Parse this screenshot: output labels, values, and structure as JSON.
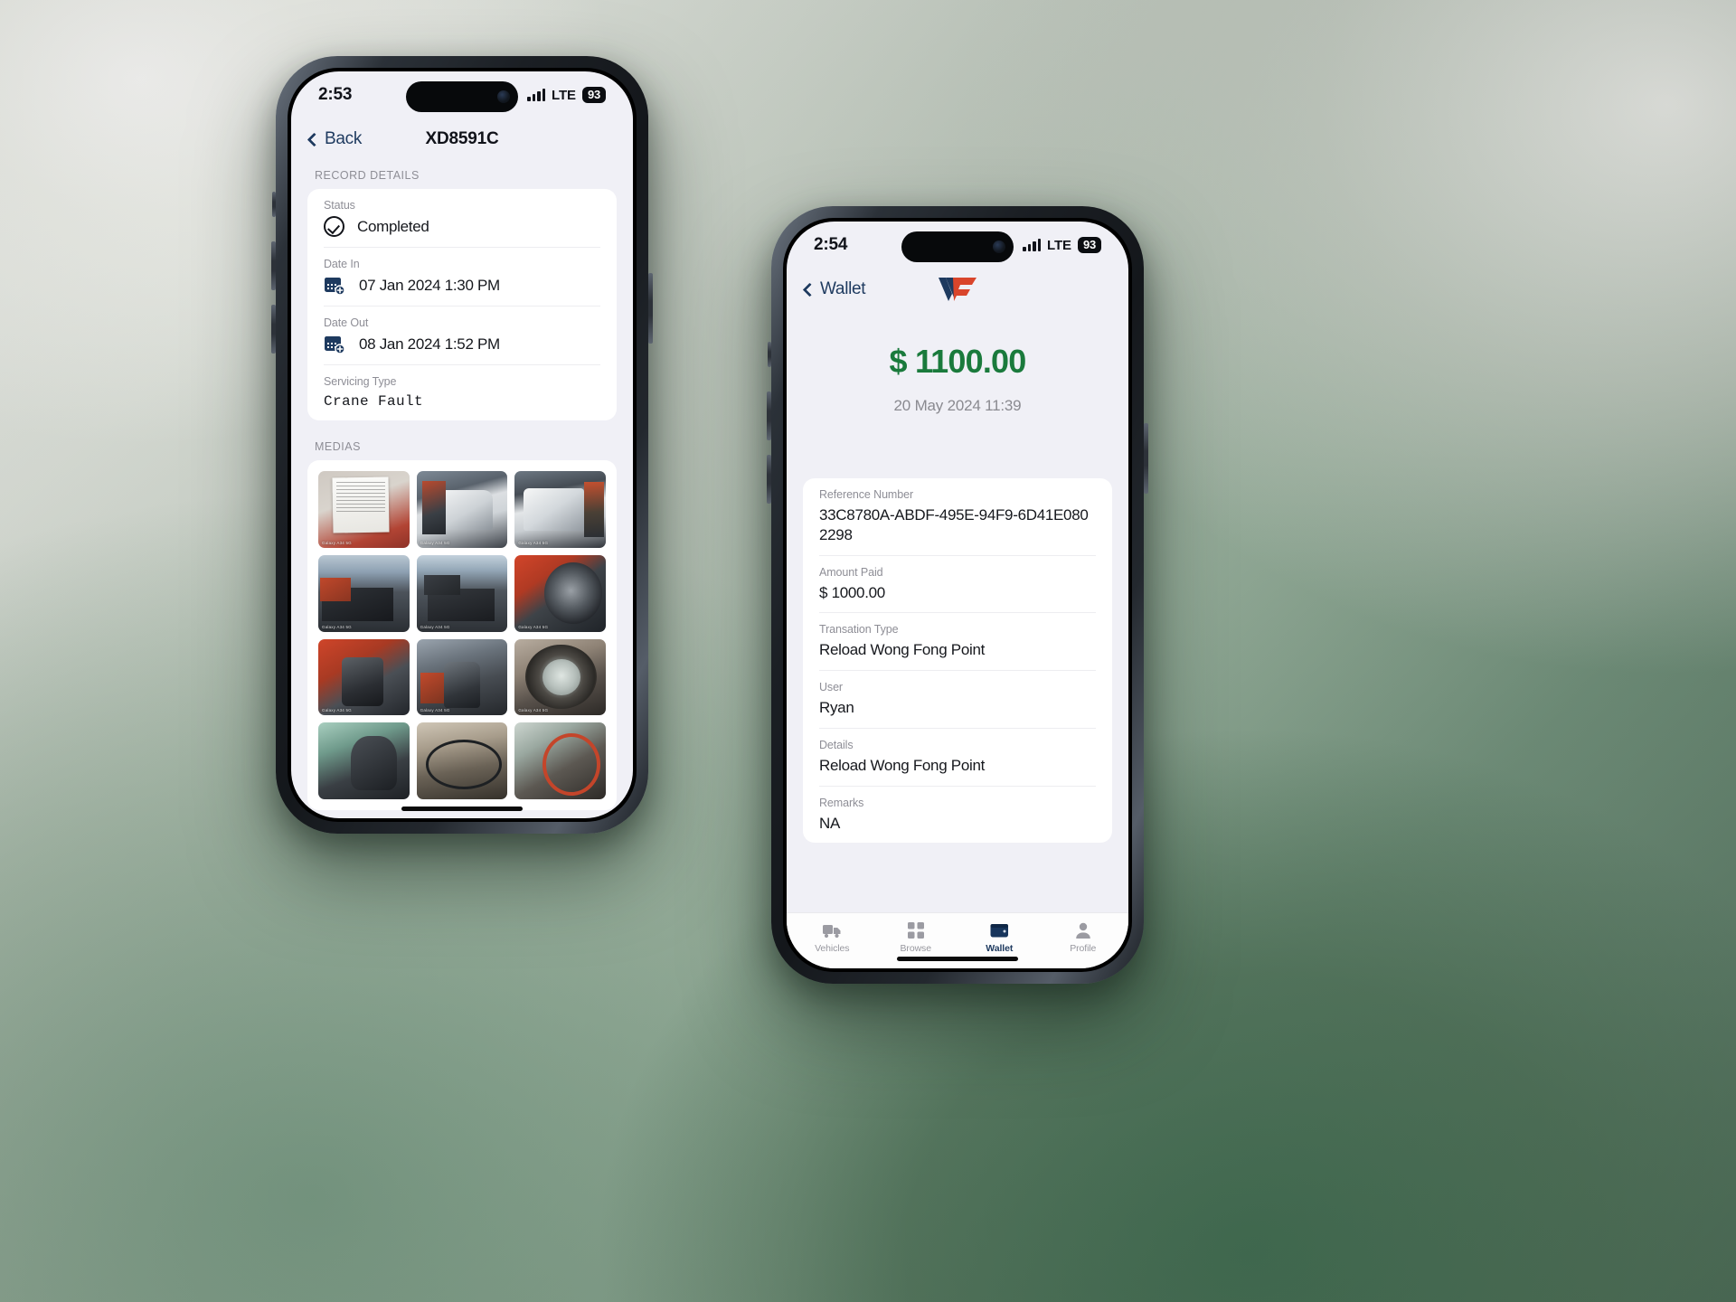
{
  "background": {
    "accent_green": "#6f8a78",
    "note": "soft gradient backdrop, light top-left to deep green bottom-right"
  },
  "phones": {
    "left": {
      "status_bar": {
        "time": "2:53",
        "network_label": "LTE",
        "battery_level": "93",
        "signal_icon": "signal-bars-icon",
        "camera_icon": "front-camera-icon"
      },
      "nav": {
        "back_label": "Back",
        "back_icon": "chevron-left-icon",
        "title": "XD8591C"
      },
      "record_section": {
        "header": "RECORD DETAILS",
        "fields": [
          {
            "label": "Status",
            "value": "Completed",
            "icon": "check-circle-icon",
            "mono": false
          },
          {
            "label": "Date In",
            "value": "07 Jan 2024 1:30 PM",
            "icon": "calendar-add-icon",
            "mono": false
          },
          {
            "label": "Date Out",
            "value": "08 Jan 2024 1:52 PM",
            "icon": "calendar-add-icon",
            "mono": false
          },
          {
            "label": "Servicing Type",
            "value": "Crane Fault",
            "icon": "",
            "mono": true
          }
        ]
      },
      "medias_section": {
        "header": "MEDIAS",
        "watermark": "Galaxy A34 5G",
        "thumbnails": [
          {
            "name": "job-sheet-document-photo",
            "style": "p-doc"
          },
          {
            "name": "scania-truck-front-photo",
            "style": "p-truck1"
          },
          {
            "name": "scania-truck-cab-photo",
            "style": "p-truck2"
          },
          {
            "name": "crane-truck-workshop-photo",
            "style": "p-yard1"
          },
          {
            "name": "crane-truck-rear-photo",
            "style": "p-yard2"
          },
          {
            "name": "crane-hub-flange-photo",
            "style": "p-hub"
          },
          {
            "name": "crane-slew-motor-photo",
            "style": "p-eng1"
          },
          {
            "name": "crane-gearbox-photo",
            "style": "p-eng2"
          },
          {
            "name": "slew-bearing-race-photo",
            "style": "p-bear"
          },
          {
            "name": "parts-cleanup-photo-1",
            "style": "p-cut1"
          },
          {
            "name": "parts-cleanup-photo-2",
            "style": "p-cut2"
          },
          {
            "name": "parts-cleanup-photo-3",
            "style": "p-cut3"
          }
        ]
      }
    },
    "right": {
      "status_bar": {
        "time": "2:54",
        "network_label": "LTE",
        "battery_level": "93",
        "signal_icon": "signal-bars-icon",
        "camera_icon": "front-camera-icon"
      },
      "nav": {
        "back_label": "Wallet",
        "back_icon": "chevron-left-icon",
        "logo": "wong-fong-wf-logo",
        "logo_colors": {
          "w": "#1e3a5f",
          "f": "#d9452b"
        }
      },
      "summary": {
        "amount": "$ 1100.00",
        "amount_color": "#1a7a3c",
        "timestamp": "20 May 2024 11:39"
      },
      "transaction_fields": [
        {
          "label": "Reference Number",
          "value": "33C8780A-ABDF-495E-94F9-6D41E0802298"
        },
        {
          "label": "Amount Paid",
          "value": "$ 1000.00"
        },
        {
          "label": "Transation Type",
          "value": "Reload Wong Fong Point"
        },
        {
          "label": "User",
          "value": "Ryan"
        },
        {
          "label": "Details",
          "value": "Reload Wong Fong Point"
        },
        {
          "label": "Remarks",
          "value": "NA"
        }
      ],
      "tabs": [
        {
          "label": "Vehicles",
          "icon": "truck-icon",
          "active": false
        },
        {
          "label": "Browse",
          "icon": "grid-icon",
          "active": false
        },
        {
          "label": "Wallet",
          "icon": "wallet-icon",
          "active": true
        },
        {
          "label": "Profile",
          "icon": "person-icon",
          "active": false
        }
      ]
    }
  }
}
